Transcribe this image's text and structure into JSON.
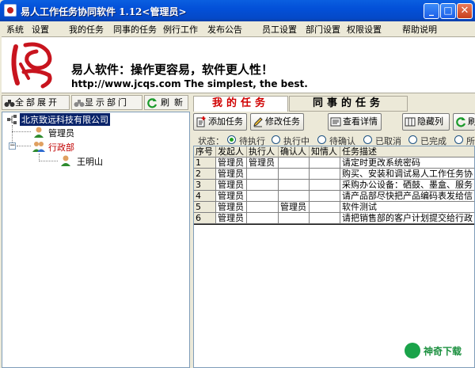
{
  "window": {
    "title": "易人工作任务协同软件 1.12<管理员>"
  },
  "window_controls": {
    "minimize": "_",
    "maximize": "□",
    "close": "✕"
  },
  "menu": [
    "系统",
    "设置",
    "我的任务",
    "同事的任务",
    "例行工作",
    "发布公告",
    "员工设置",
    "部门设置",
    "权限设置",
    "帮助说明"
  ],
  "banner": {
    "slogan": "易人软件：操作更容易，软件更人性！",
    "url_line": "http://www.jcqs.com   The simplest, the best."
  },
  "left_toolbar": {
    "expand_all": "全部展开",
    "show_dept": "显示部门",
    "refresh": "刷新"
  },
  "tree": {
    "root": "北京致远科技有限公司",
    "nodes": [
      {
        "label": "管理员",
        "type": "user"
      },
      {
        "label": "行政部",
        "type": "department",
        "color": "#c00000",
        "expander": "−"
      },
      {
        "label": "王明山",
        "type": "user"
      }
    ]
  },
  "tabs": {
    "mine": "我的任务",
    "peer": "同事的任务"
  },
  "actions": {
    "add": "添加任务",
    "edit": "修改任务",
    "detail": "查看详情",
    "hide_col": "隐藏列",
    "refresh_partial": "刷"
  },
  "status_filter": {
    "label": "状态：",
    "options": [
      "待执行",
      "执行中",
      "待确认",
      "已取消",
      "已完成",
      "所"
    ],
    "selected": "待执行"
  },
  "grid": {
    "columns": [
      "序号",
      "发起人",
      "执行人",
      "确认人",
      "知情人",
      "任务描述"
    ],
    "rows": [
      [
        "1",
        "管理员",
        "管理员",
        "",
        "",
        "请定时更改系统密码"
      ],
      [
        "2",
        "管理员",
        "",
        "",
        "",
        "购买、安装和调试易人工作任务协"
      ],
      [
        "3",
        "管理员",
        "",
        "",
        "",
        "采购办公设备：硒鼓、墨盒、服务"
      ],
      [
        "4",
        "管理员",
        "",
        "",
        "",
        "请产品部尽快把产品编码表发给信"
      ],
      [
        "5",
        "管理员",
        "",
        "管理员",
        "",
        "软件测试"
      ],
      [
        "6",
        "管理员",
        "",
        "",
        "",
        "请把销售部的客户计划提交给行政"
      ]
    ]
  },
  "watermark": {
    "text": "神奇下载"
  },
  "colors": {
    "title_bar": "#0350d8",
    "selected_tree": "#0a246a",
    "tab_active_text": "#d00000",
    "department_text": "#c00000"
  }
}
